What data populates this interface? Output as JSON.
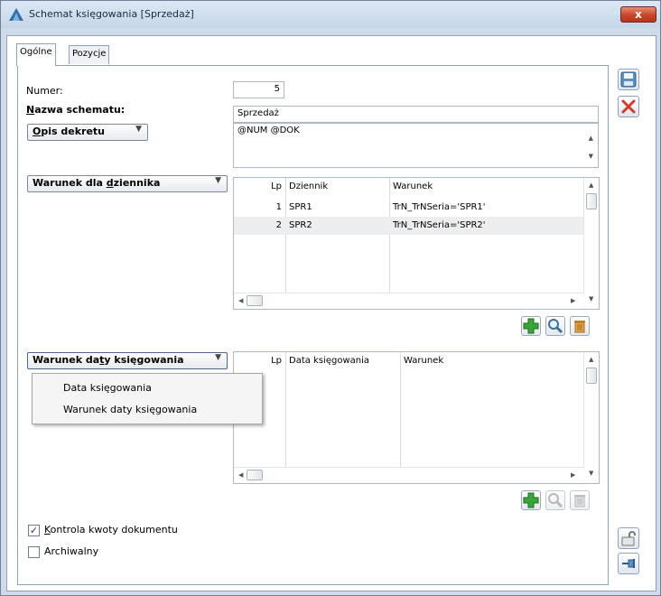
{
  "window": {
    "title": "Schemat księgowania [Sprzedaż]",
    "close_label": "x"
  },
  "tabs": [
    {
      "label": "Ogólne"
    },
    {
      "label": "Pozycje"
    }
  ],
  "form": {
    "numer_label": "Numer:",
    "numer_value": "5",
    "nazwa_label_u": "N",
    "nazwa_label_rest": "azwa schematu:",
    "nazwa_value": "Sprzedaż",
    "opis_btn_u": "O",
    "opis_btn_rest": "pis dekretu",
    "opis_value": "@NUM @DOK"
  },
  "journal": {
    "button_pre": "Warunek dla ",
    "button_u": "d",
    "button_post": "ziennika",
    "columns": [
      "Lp",
      "Dziennik",
      "Warunek"
    ],
    "rows": [
      {
        "lp": "1",
        "dziennik": "SPR1",
        "warunek": "TrN_TrNSeria='SPR1'"
      },
      {
        "lp": "2",
        "dziennik": "SPR2",
        "warunek": "TrN_TrNSeria='SPR2'"
      }
    ]
  },
  "date": {
    "button_pre": "Warunek da",
    "button_u": "t",
    "button_post": "y księgowania",
    "columns": [
      "Lp",
      "Data księgowania",
      "Warunek"
    ]
  },
  "menu": {
    "items": [
      "Data księgowania",
      "Warunek daty księgowania"
    ]
  },
  "options": {
    "kontrola_u": "K",
    "kontrola_rest": "ontrola kwoty dokumentu",
    "kontrola_checked": true,
    "archiwalny_label": "Archiwalny",
    "archiwalny_checked": false
  },
  "checkmark": "✓",
  "colors": {
    "accent": "#2f6fae",
    "add_green": "#3aa53a",
    "close_red": "#d04a2b",
    "delete_orange": "#c9872b"
  }
}
